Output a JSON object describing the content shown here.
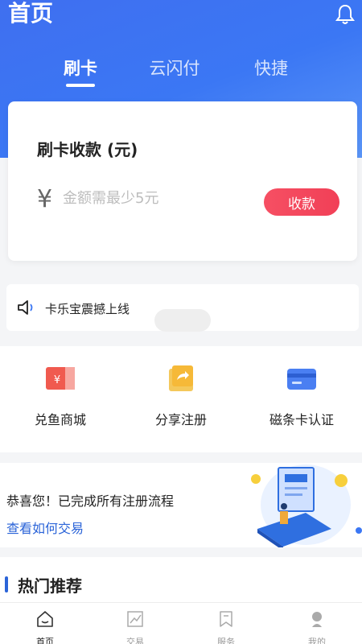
{
  "header": {
    "title": "首页",
    "bell_icon": "bell-icon"
  },
  "tabs": [
    {
      "label": "刷卡",
      "active": true
    },
    {
      "label": "云闪付",
      "active": false
    },
    {
      "label": "快捷",
      "active": false
    }
  ],
  "payment_card": {
    "title": "刷卡收款 (元)",
    "currency_symbol": "¥",
    "amount_placeholder": "金额需最少5元",
    "amount_value": "",
    "collect_button": "收款"
  },
  "notice": {
    "icon": "speaker-icon",
    "text": "卡乐宝震撼上线"
  },
  "quick_actions": [
    {
      "label": "兑鱼商城",
      "icon": "coupon-icon"
    },
    {
      "label": "分享注册",
      "icon": "share-icon"
    },
    {
      "label": "磁条卡认证",
      "icon": "card-icon"
    }
  ],
  "banner": {
    "title": "恭喜您！已完成所有注册流程",
    "link": "查看如何交易"
  },
  "section": {
    "title": "热门推荐"
  },
  "tabbar": [
    {
      "label": "首页",
      "icon": "home-icon",
      "active": true
    },
    {
      "label": "交易",
      "icon": "chart-icon",
      "active": false
    },
    {
      "label": "服务",
      "icon": "bookmark-icon",
      "active": false
    },
    {
      "label": "我的",
      "icon": "profile-icon",
      "active": false
    }
  ],
  "colors": {
    "primary_blue": "#3f6ff0",
    "collect_red": "#f14057",
    "link_blue": "#2b64d8"
  }
}
